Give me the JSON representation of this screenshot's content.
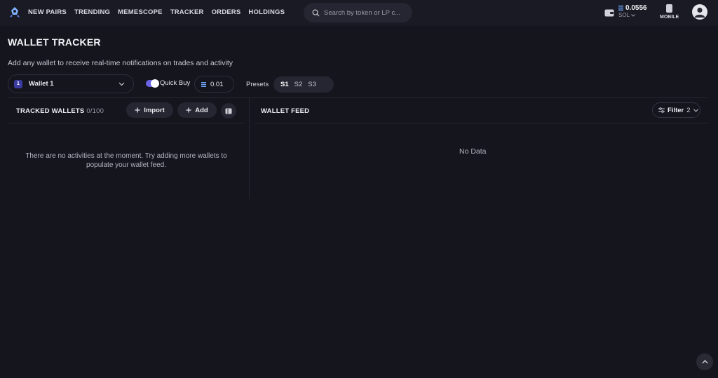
{
  "nav": {
    "items": [
      {
        "label": "NEW PAIRS"
      },
      {
        "label": "TRENDING"
      },
      {
        "label": "MEMESCOPE"
      },
      {
        "label": "TRACKER"
      },
      {
        "label": "ORDERS"
      },
      {
        "label": "HOLDINGS"
      }
    ],
    "search_placeholder": "Search by token or LP c...",
    "balance": "0.0556",
    "currency": "SOL",
    "mobile_label": "MOBILE"
  },
  "page": {
    "title": "WALLET TRACKER",
    "subtitle": "Add any wallet to receive real-time notifications on trades and activity"
  },
  "controls": {
    "wallet_number": "1",
    "wallet_name": "Wallet 1",
    "quick_buy_label": "Quick Buy",
    "quick_buy_enabled": true,
    "amount": "0.01",
    "presets_label": "Presets",
    "presets": [
      "S1",
      "S2",
      "S3"
    ],
    "active_preset": "S1"
  },
  "tracked": {
    "title": "TRACKED WALLETS",
    "count": "0/100",
    "import_label": "Import",
    "add_label": "Add",
    "empty_message": "There are no activities at the moment. Try adding more wallets to populate your wallet feed."
  },
  "feed": {
    "title": "WALLET FEED",
    "filter_label": "Filter",
    "filter_count": "2",
    "empty_message": "No Data"
  },
  "colors": {
    "background": "#15151d",
    "accent": "#6b63e6",
    "surface": "#262632"
  },
  "icons": [
    "app-logo-icon",
    "search-icon",
    "wallet-icon",
    "sol-icon",
    "chevron-down-icon",
    "mobile-icon",
    "user-avatar-icon",
    "plus-icon",
    "columns-icon",
    "sliders-icon",
    "chevron-up-icon"
  ]
}
